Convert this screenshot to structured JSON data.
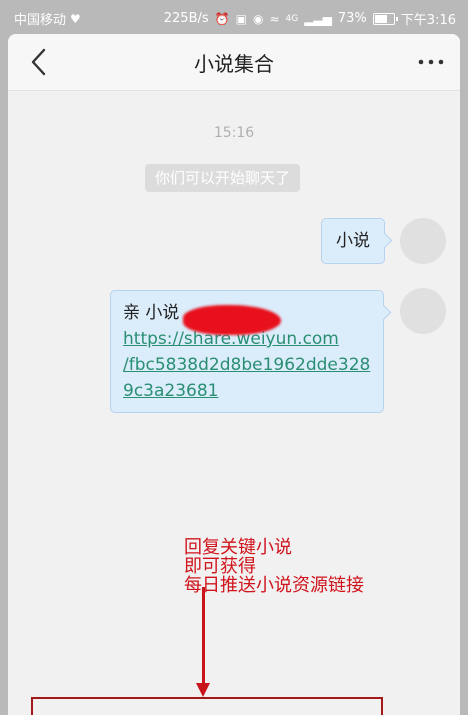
{
  "status_bar": {
    "carrier": "中国移动",
    "speed": "225B/s",
    "signal_label": "4G",
    "battery": "73%",
    "battery_level": 0.73,
    "time": "下午3:16"
  },
  "header": {
    "title": "小说集合",
    "back_icon": "chevron-left-icon",
    "more_icon": "more-dots-icon"
  },
  "chat": {
    "timestamp": "15:16",
    "system_note": "你们可以开始聊天了",
    "messages": [
      {
        "type": "text",
        "text": "小说"
      },
      {
        "type": "link",
        "prefix": "亲 小说",
        "link_lines": [
          "https://share.weiyun.com",
          "/fbc5838d2d8be1962dde328",
          "9c3a23681"
        ]
      }
    ]
  },
  "annotation": {
    "lines": [
      "回复关键小说",
      "即可获得",
      "每日推送小说资源链接"
    ],
    "color": "#d0141c"
  },
  "colors": {
    "bubble_bg": "#dbecfb",
    "bubble_border": "#b8d3ee",
    "link": "#2a8f72",
    "annotation_red": "#d0141c"
  }
}
